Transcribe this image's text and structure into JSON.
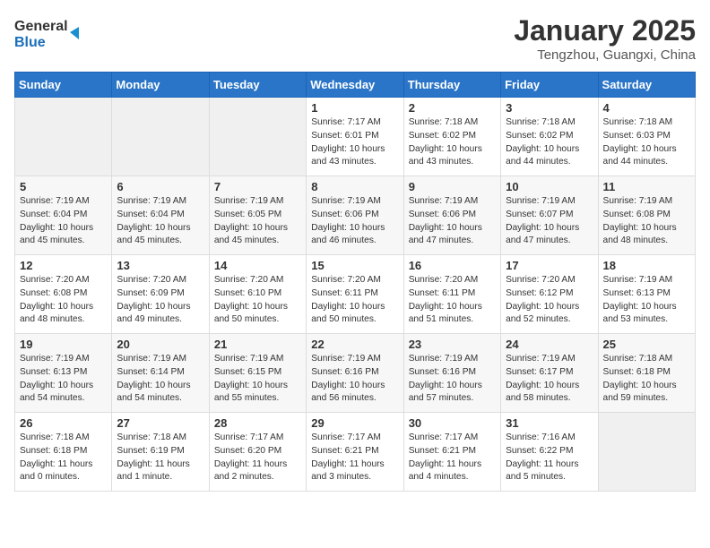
{
  "header": {
    "logo_line1": "General",
    "logo_line2": "Blue",
    "month": "January 2025",
    "location": "Tengzhou, Guangxi, China"
  },
  "weekdays": [
    "Sunday",
    "Monday",
    "Tuesday",
    "Wednesday",
    "Thursday",
    "Friday",
    "Saturday"
  ],
  "weeks": [
    [
      {
        "day": "",
        "info": ""
      },
      {
        "day": "",
        "info": ""
      },
      {
        "day": "",
        "info": ""
      },
      {
        "day": "1",
        "info": "Sunrise: 7:17 AM\nSunset: 6:01 PM\nDaylight: 10 hours\nand 43 minutes."
      },
      {
        "day": "2",
        "info": "Sunrise: 7:18 AM\nSunset: 6:02 PM\nDaylight: 10 hours\nand 43 minutes."
      },
      {
        "day": "3",
        "info": "Sunrise: 7:18 AM\nSunset: 6:02 PM\nDaylight: 10 hours\nand 44 minutes."
      },
      {
        "day": "4",
        "info": "Sunrise: 7:18 AM\nSunset: 6:03 PM\nDaylight: 10 hours\nand 44 minutes."
      }
    ],
    [
      {
        "day": "5",
        "info": "Sunrise: 7:19 AM\nSunset: 6:04 PM\nDaylight: 10 hours\nand 45 minutes."
      },
      {
        "day": "6",
        "info": "Sunrise: 7:19 AM\nSunset: 6:04 PM\nDaylight: 10 hours\nand 45 minutes."
      },
      {
        "day": "7",
        "info": "Sunrise: 7:19 AM\nSunset: 6:05 PM\nDaylight: 10 hours\nand 45 minutes."
      },
      {
        "day": "8",
        "info": "Sunrise: 7:19 AM\nSunset: 6:06 PM\nDaylight: 10 hours\nand 46 minutes."
      },
      {
        "day": "9",
        "info": "Sunrise: 7:19 AM\nSunset: 6:06 PM\nDaylight: 10 hours\nand 47 minutes."
      },
      {
        "day": "10",
        "info": "Sunrise: 7:19 AM\nSunset: 6:07 PM\nDaylight: 10 hours\nand 47 minutes."
      },
      {
        "day": "11",
        "info": "Sunrise: 7:19 AM\nSunset: 6:08 PM\nDaylight: 10 hours\nand 48 minutes."
      }
    ],
    [
      {
        "day": "12",
        "info": "Sunrise: 7:20 AM\nSunset: 6:08 PM\nDaylight: 10 hours\nand 48 minutes."
      },
      {
        "day": "13",
        "info": "Sunrise: 7:20 AM\nSunset: 6:09 PM\nDaylight: 10 hours\nand 49 minutes."
      },
      {
        "day": "14",
        "info": "Sunrise: 7:20 AM\nSunset: 6:10 PM\nDaylight: 10 hours\nand 50 minutes."
      },
      {
        "day": "15",
        "info": "Sunrise: 7:20 AM\nSunset: 6:11 PM\nDaylight: 10 hours\nand 50 minutes."
      },
      {
        "day": "16",
        "info": "Sunrise: 7:20 AM\nSunset: 6:11 PM\nDaylight: 10 hours\nand 51 minutes."
      },
      {
        "day": "17",
        "info": "Sunrise: 7:20 AM\nSunset: 6:12 PM\nDaylight: 10 hours\nand 52 minutes."
      },
      {
        "day": "18",
        "info": "Sunrise: 7:19 AM\nSunset: 6:13 PM\nDaylight: 10 hours\nand 53 minutes."
      }
    ],
    [
      {
        "day": "19",
        "info": "Sunrise: 7:19 AM\nSunset: 6:13 PM\nDaylight: 10 hours\nand 54 minutes."
      },
      {
        "day": "20",
        "info": "Sunrise: 7:19 AM\nSunset: 6:14 PM\nDaylight: 10 hours\nand 54 minutes."
      },
      {
        "day": "21",
        "info": "Sunrise: 7:19 AM\nSunset: 6:15 PM\nDaylight: 10 hours\nand 55 minutes."
      },
      {
        "day": "22",
        "info": "Sunrise: 7:19 AM\nSunset: 6:16 PM\nDaylight: 10 hours\nand 56 minutes."
      },
      {
        "day": "23",
        "info": "Sunrise: 7:19 AM\nSunset: 6:16 PM\nDaylight: 10 hours\nand 57 minutes."
      },
      {
        "day": "24",
        "info": "Sunrise: 7:19 AM\nSunset: 6:17 PM\nDaylight: 10 hours\nand 58 minutes."
      },
      {
        "day": "25",
        "info": "Sunrise: 7:18 AM\nSunset: 6:18 PM\nDaylight: 10 hours\nand 59 minutes."
      }
    ],
    [
      {
        "day": "26",
        "info": "Sunrise: 7:18 AM\nSunset: 6:18 PM\nDaylight: 11 hours\nand 0 minutes."
      },
      {
        "day": "27",
        "info": "Sunrise: 7:18 AM\nSunset: 6:19 PM\nDaylight: 11 hours\nand 1 minute."
      },
      {
        "day": "28",
        "info": "Sunrise: 7:17 AM\nSunset: 6:20 PM\nDaylight: 11 hours\nand 2 minutes."
      },
      {
        "day": "29",
        "info": "Sunrise: 7:17 AM\nSunset: 6:21 PM\nDaylight: 11 hours\nand 3 minutes."
      },
      {
        "day": "30",
        "info": "Sunrise: 7:17 AM\nSunset: 6:21 PM\nDaylight: 11 hours\nand 4 minutes."
      },
      {
        "day": "31",
        "info": "Sunrise: 7:16 AM\nSunset: 6:22 PM\nDaylight: 11 hours\nand 5 minutes."
      },
      {
        "day": "",
        "info": ""
      }
    ]
  ]
}
